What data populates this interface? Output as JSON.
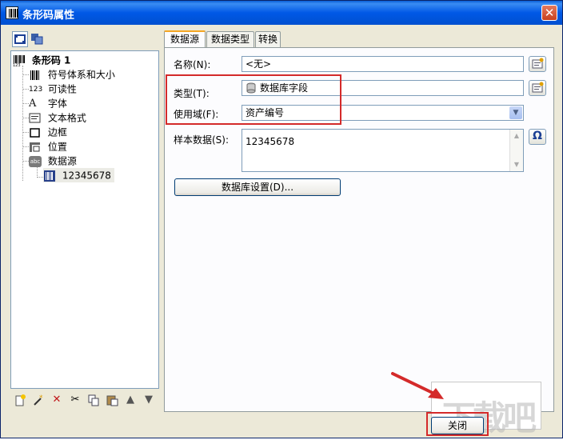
{
  "window": {
    "title": "条形码属性",
    "close_glyph": "✕"
  },
  "tree": {
    "root": "条形码 1",
    "items": [
      {
        "label": "符号体系和大小",
        "icon": "barcode-icon"
      },
      {
        "label": "可读性",
        "icon": "numbers-icon",
        "prefix": "123"
      },
      {
        "label": "字体",
        "icon": "font-icon",
        "prefix": "A"
      },
      {
        "label": "文本格式",
        "icon": "text-format-icon"
      },
      {
        "label": "边框",
        "icon": "border-icon"
      },
      {
        "label": "位置",
        "icon": "position-icon"
      },
      {
        "label": "数据源",
        "icon": "datasource-icon",
        "prefix": "abc"
      }
    ],
    "child": "12345678"
  },
  "bottom_toolbar": [
    "new-icon",
    "wizard-icon",
    "delete-icon",
    "cut-icon",
    "copy-icon",
    "paste-icon",
    "up-icon",
    "down-icon"
  ],
  "tabs": [
    "数据源",
    "数据类型",
    "转换"
  ],
  "form": {
    "name_label": "名称(N):",
    "name_value": "<无>",
    "type_label": "类型(T):",
    "type_value": "数据库字段",
    "field_label": "使用域(F):",
    "field_value": "资产编号",
    "sample_label": "样本数据(S):",
    "sample_value": "12345678",
    "db_button": "数据库设置(D)...",
    "omega": "Ω"
  },
  "footer": {
    "close_button": "关闭"
  },
  "colors": {
    "highlight": "#d42a2a",
    "titlebar": "#0058e6"
  }
}
